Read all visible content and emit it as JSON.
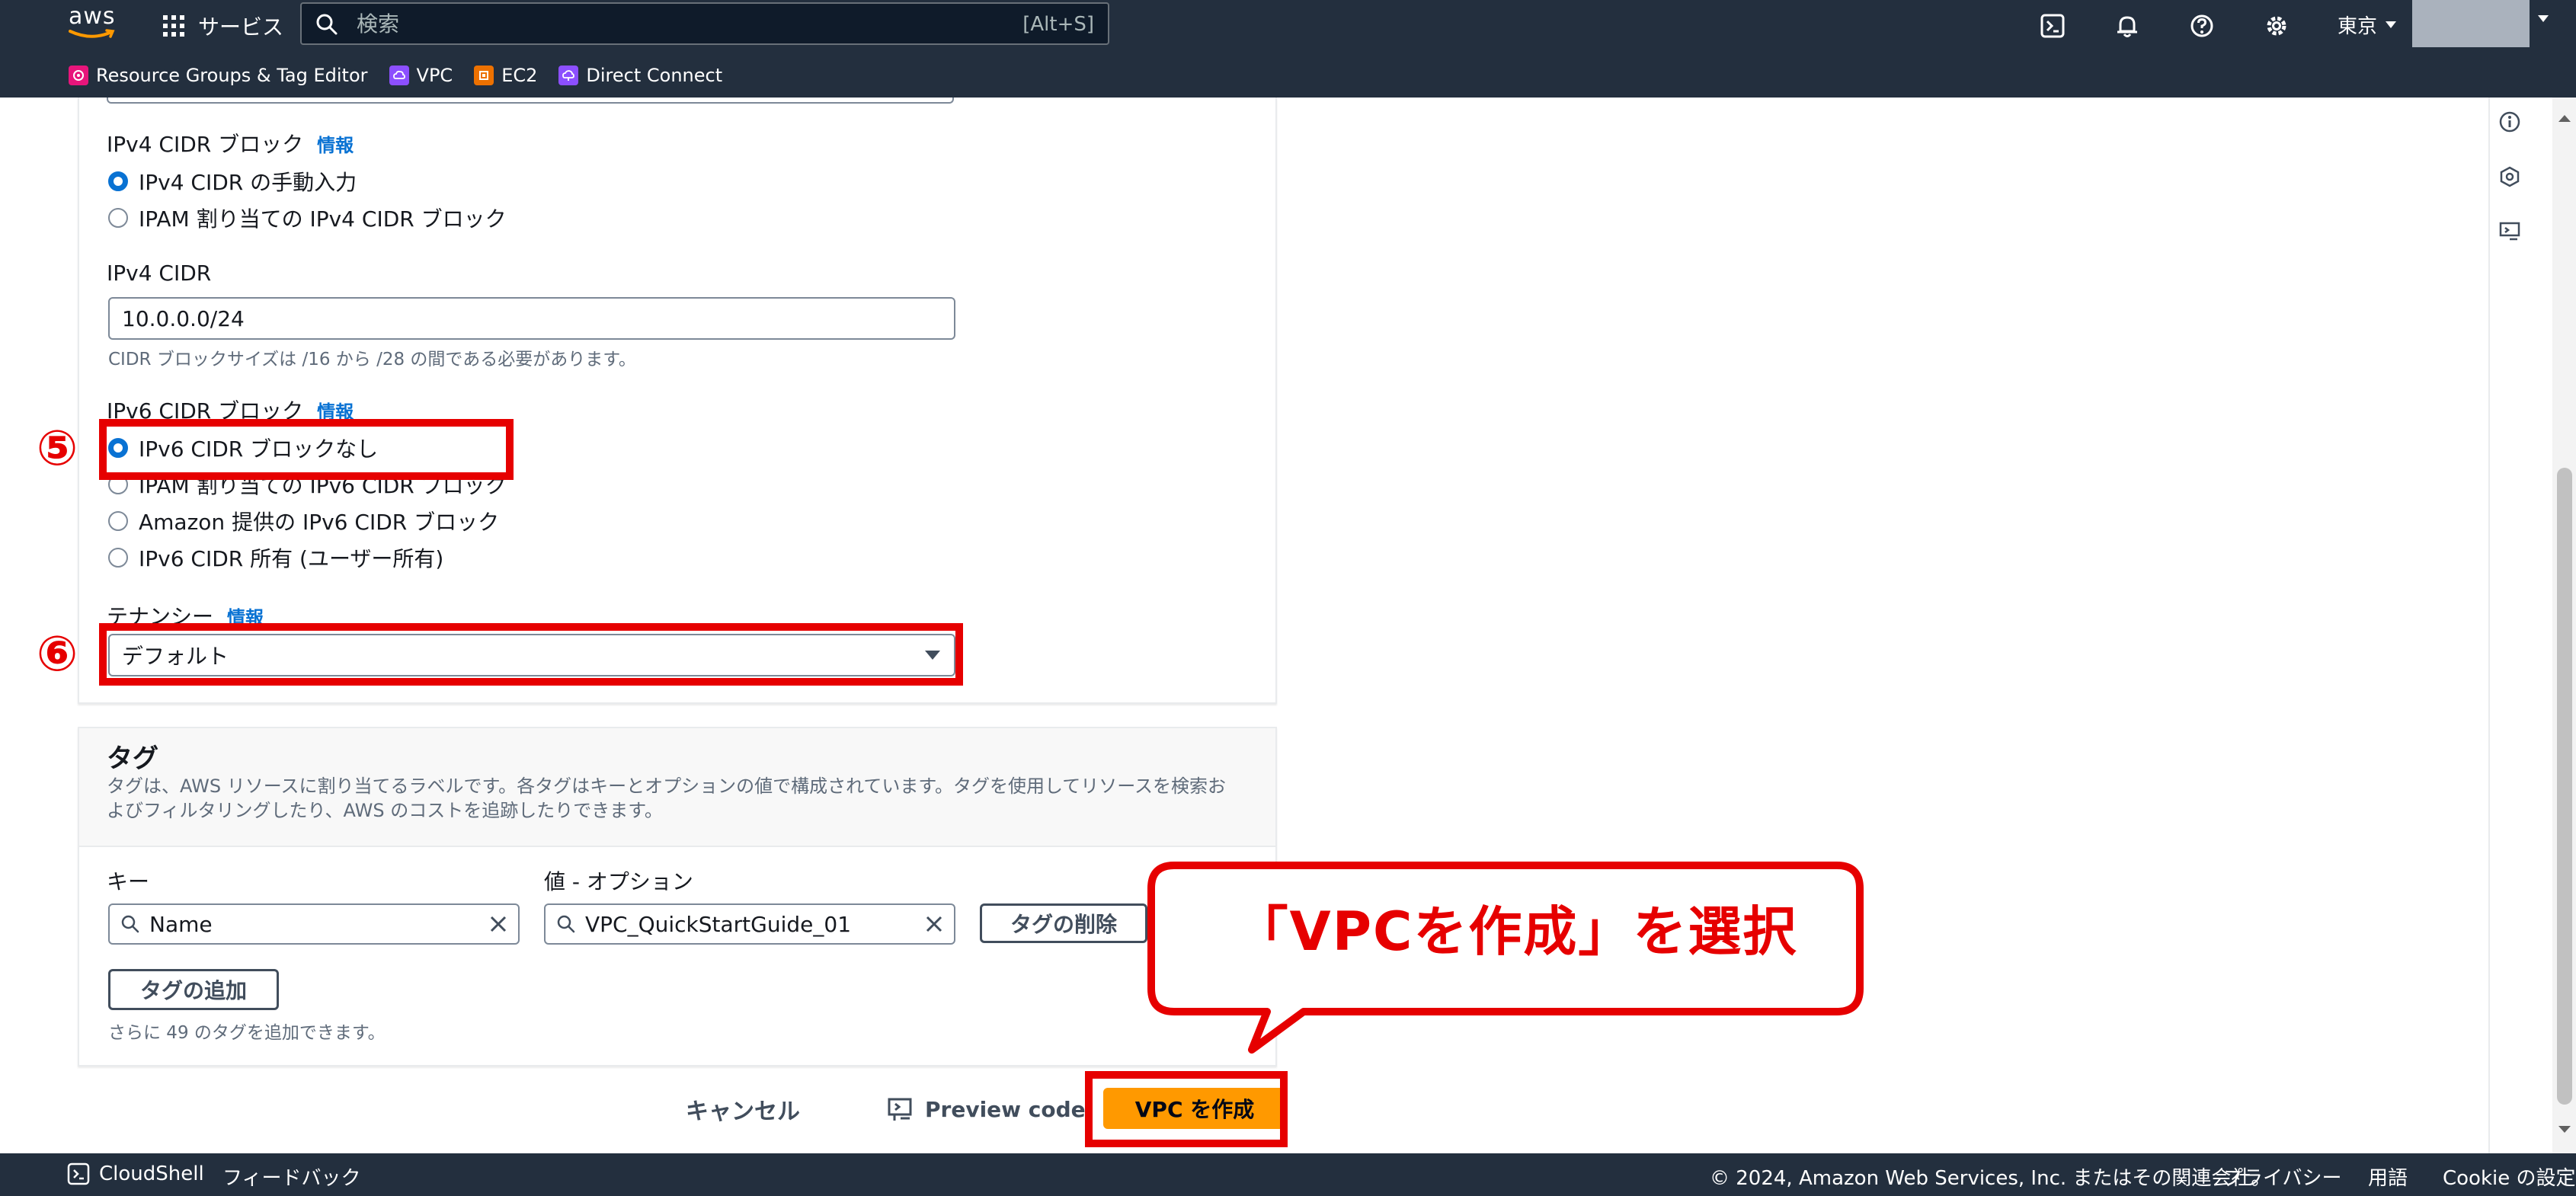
{
  "topnav": {
    "logo_text": "aws",
    "services_label": "サービス",
    "search": {
      "placeholder": "検索",
      "shortcut": "[Alt+S]"
    },
    "region": "東京",
    "icons": [
      "cloudshell-icon",
      "bell-icon",
      "help-icon",
      "settings-icon"
    ]
  },
  "favorites": [
    {
      "label": "Resource Groups & Tag Editor",
      "color": "#e7157b"
    },
    {
      "label": "VPC",
      "color": "#8c4fff"
    },
    {
      "label": "EC2",
      "color": "#ed7100"
    },
    {
      "label": "Direct Connect",
      "color": "#8c4fff"
    }
  ],
  "form": {
    "ipv4_block": {
      "label": "IPv4 CIDR ブロック",
      "info": "情報",
      "options": [
        "IPv4 CIDR の手動入力",
        "IPAM 割り当ての IPv4 CIDR ブロック"
      ],
      "selected_index": 0
    },
    "ipv4_cidr": {
      "label": "IPv4 CIDR",
      "value": "10.0.0.0/24",
      "hint": "CIDR ブロックサイズは /16 から /28 の間である必要があります。"
    },
    "ipv6_block": {
      "label": "IPv6 CIDR ブロック",
      "info": "情報",
      "options": [
        "IPv6 CIDR ブロックなし",
        "IPAM 割り当ての IPv6 CIDR ブロック",
        "Amazon 提供の IPv6 CIDR ブロック",
        "IPv6 CIDR 所有 (ユーザー所有)"
      ],
      "selected_index": 0
    },
    "tenancy": {
      "label": "テナンシー",
      "info": "情報",
      "value": "デフォルト"
    }
  },
  "tags": {
    "title": "タグ",
    "description": "タグは、AWS リソースに割り当てるラベルです。各タグはキーとオプションの値で構成されています。タグを使用してリソースを検索およびフィルタリングしたり、AWS のコストを追跡したりできます。",
    "key_label": "キー",
    "value_label": "値 - オプション",
    "key_value": "Name",
    "value_value": "VPC_QuickStartGuide_01",
    "remove_label": "タグの削除",
    "add_label": "タグの追加",
    "remaining_hint": "さらに 49 のタグを追加できます。"
  },
  "actions": {
    "cancel": "キャンセル",
    "preview": "Preview code",
    "create": "VPC を作成"
  },
  "annotations": {
    "step5": "⑤",
    "step6": "⑥",
    "callout": "「VPCを作成」を選択",
    "color": "#e60000"
  },
  "footer": {
    "cloudshell": "CloudShell",
    "feedback": "フィードバック",
    "copyright": "© 2024, Amazon Web Services, Inc. またはその関連会社。",
    "privacy": "プライバシー",
    "terms": "用語",
    "cookie": "Cookie の設定"
  }
}
